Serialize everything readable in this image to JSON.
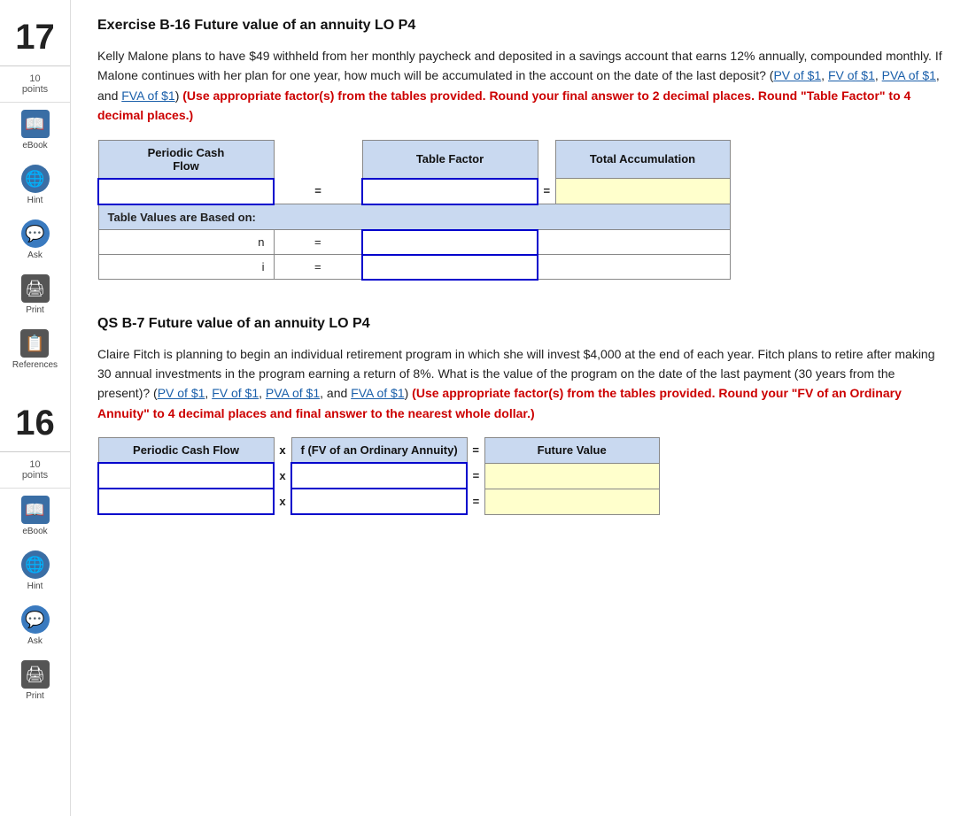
{
  "sidebar": {
    "section1": {
      "number": "17",
      "points_value": "10",
      "points_label": "points"
    },
    "section2": {
      "number": "16",
      "points_value": "10",
      "points_label": "points"
    },
    "items": [
      {
        "id": "ebook",
        "icon": "📖",
        "label": "eBook"
      },
      {
        "id": "hint",
        "icon": "🌐",
        "label": "Hint"
      },
      {
        "id": "ask",
        "icon": "💬",
        "label": "Ask"
      },
      {
        "id": "print",
        "icon": "🖨",
        "label": "Print"
      },
      {
        "id": "references",
        "icon": "📋",
        "label": "References"
      }
    ]
  },
  "problem1": {
    "title": "Exercise B-16 Future value of an annuity LO P4",
    "body_part1": "Kelly Malone plans to have $49 withheld from her monthly paycheck and deposited in a savings account that earns 12% annually, compounded monthly. If Malone continues with her plan for one year, how much will be accumulated in the account on the date of the last deposit? (",
    "link1": "PV of $1",
    "comma1": ", ",
    "link2": "FV of $1",
    "comma2": ", ",
    "link3": "PVA of $1",
    "comma3": ", and ",
    "link4": "FVA of $1",
    "body_part2": ") ",
    "red_text": "(Use appropriate factor(s) from the tables provided. Round your final answer to 2 decimal places. Round \"Table Factor\" to 4 decimal places.)",
    "table": {
      "col1": "Periodic Cash\nFlow",
      "col2": "Table Factor",
      "col3": "Total Accumulation",
      "row1": {
        "col1_val": "",
        "col2_val": "",
        "equals": "=",
        "col3_val": ""
      },
      "table_values_label": "Table Values are Based on:",
      "n_label": "n",
      "n_eq": "=",
      "n_val": "",
      "i_label": "i",
      "i_eq": "=",
      "i_val": ""
    }
  },
  "problem2": {
    "title": "QS B-7 Future value of an annuity LO P4",
    "body_part1": "Claire Fitch is planning to begin an individual retirement program in which she will invest $4,000 at the end of each year. Fitch plans to retire after making 30 annual investments in the program earning a return of 8%. What is the value of the program on the date of the last payment (30 years from the present)? (",
    "link1": "PV of $1",
    "comma1": ", ",
    "link2": "FV of $1",
    "comma2": ", ",
    "link3": "PVA of $1",
    "comma3": ", and ",
    "link4": "FVA of $1",
    "body_part2": ") ",
    "red_text": "(Use appropriate factor(s) from the tables provided. Round your \"FV of an Ordinary Annuity\" to 4 decimal places and final answer to the nearest whole dollar.)",
    "table": {
      "col1": "Periodic Cash Flow",
      "col_x": "x",
      "col2": "f (FV of an Ordinary Annuity)",
      "col_eq": "=",
      "col3": "Future Value",
      "row1": {
        "col1_val": "",
        "col2_val": "",
        "col3_val": ""
      },
      "row2": {
        "col1_val": "",
        "col_x2": "x",
        "col2_val": "",
        "col3_val": ""
      }
    }
  }
}
